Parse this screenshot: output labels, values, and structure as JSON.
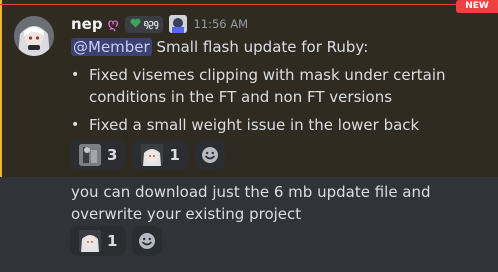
{
  "new_badge": "NEW",
  "message": {
    "username": "nep",
    "username_glyph": "ღ",
    "tag_text": "ᦏᦳᧁ",
    "timestamp": "11:56 AM",
    "mention": "@Member",
    "text": "Small flash update for Ruby:",
    "bullets": [
      "Fixed visemes clipping with mask under certain conditions in the FT and non FT versions",
      "Fixed a small weight issue in the lower back"
    ],
    "reactions": [
      {
        "icon": "figure-emoji",
        "count": "3"
      },
      {
        "icon": "anime-girl-emoji",
        "count": "1"
      }
    ]
  },
  "followup": {
    "text": "you can download just the 6 mb update file and overwrite your existing project",
    "reactions": [
      {
        "icon": "anime-girl-emoji",
        "count": "1"
      }
    ]
  },
  "colors": {
    "mention_highlight": "#f0b232",
    "new_badge": "#f23f42",
    "mention_pill": "#3c4270"
  }
}
